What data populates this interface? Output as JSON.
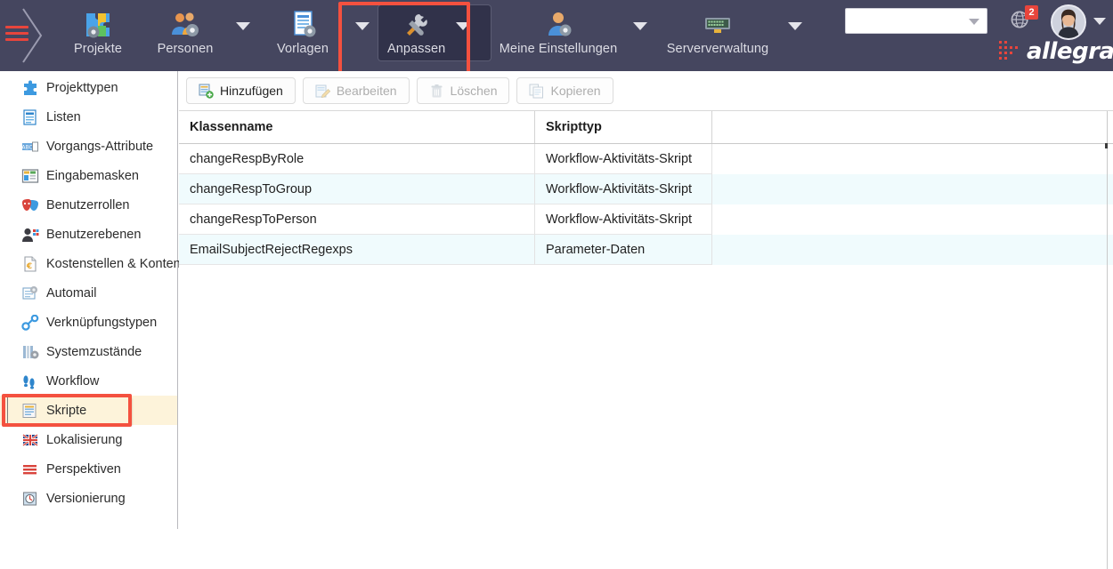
{
  "header": {
    "burger_icon": "hamburger-menu-icon",
    "nav": [
      {
        "label": "Projekte",
        "icon": "puzzle-gear-icon",
        "has_caret": false,
        "highlighted": false
      },
      {
        "label": "Personen",
        "icon": "people-gear-icon",
        "has_caret": true,
        "highlighted": false
      },
      {
        "label": "Vorlagen",
        "icon": "document-gear-icon",
        "has_caret": true,
        "highlighted": false
      },
      {
        "label": "Anpassen",
        "icon": "tools-icon",
        "has_caret": true,
        "highlighted": true
      },
      {
        "label": "Meine Einstellungen",
        "icon": "user-gear-icon",
        "has_caret": true,
        "highlighted": false
      },
      {
        "label": "Serververwaltung",
        "icon": "server-icon",
        "has_caret": true,
        "highlighted": false
      }
    ],
    "search": {
      "value": "",
      "placeholder": "",
      "icon": "chevron-down-icon"
    },
    "globe": {
      "icon": "globe-icon",
      "badge": "2"
    },
    "avatar": {
      "icon": "user-avatar",
      "caret_icon": "chevron-down-icon"
    },
    "brand": {
      "text": "allegra",
      "mark_icon": "allegra-dots-logo"
    },
    "colors": {
      "bar_bg": "#45465f",
      "tile_bg": "#31324a",
      "highlight": "#f4513f",
      "badge": "#e8453c"
    }
  },
  "sidebar": {
    "items": [
      {
        "label": "Projekttypen",
        "icon": "puzzle-icon",
        "active": false
      },
      {
        "label": "Listen",
        "icon": "list-icon",
        "active": false
      },
      {
        "label": "Vorgangs-Attribute",
        "icon": "abc-field-icon",
        "active": false
      },
      {
        "label": "Eingabemasken",
        "icon": "form-layout-icon",
        "active": false
      },
      {
        "label": "Benutzerrollen",
        "icon": "theater-masks-icon",
        "active": false
      },
      {
        "label": "Benutzerebenen",
        "icon": "user-levels-icon",
        "active": false
      },
      {
        "label": "Kostenstellen & Konten",
        "icon": "euro-document-icon",
        "active": false
      },
      {
        "label": "Automail",
        "icon": "automail-icon",
        "active": false
      },
      {
        "label": "Verknüpfungstypen",
        "icon": "link-chain-icon",
        "active": false
      },
      {
        "label": "Systemzustände",
        "icon": "system-state-icon",
        "active": false
      },
      {
        "label": "Workflow",
        "icon": "footsteps-icon",
        "active": false
      },
      {
        "label": "Skripte",
        "icon": "script-icon",
        "active": true
      },
      {
        "label": "Lokalisierung",
        "icon": "uk-flag-icon",
        "active": false
      },
      {
        "label": "Perspektiven",
        "icon": "red-bars-icon",
        "active": false
      },
      {
        "label": "Versionierung",
        "icon": "clock-version-icon",
        "active": false
      }
    ],
    "active_highlight_color": "#fdf3da"
  },
  "toolbar": {
    "buttons": [
      {
        "label": "Hinzufügen",
        "icon": "add-script-icon",
        "enabled": true
      },
      {
        "label": "Bearbeiten",
        "icon": "edit-pencil-icon",
        "enabled": false
      },
      {
        "label": "Löschen",
        "icon": "trash-icon",
        "enabled": false
      },
      {
        "label": "Kopieren",
        "icon": "copy-icon",
        "enabled": false
      }
    ]
  },
  "grid": {
    "columns": [
      "Klassenname",
      "Skripttyp",
      ""
    ],
    "rows": [
      {
        "klassenname": "changeRespByRole",
        "skripttyp": "Workflow-Aktivitäts-Skript"
      },
      {
        "klassenname": "changeRespToGroup",
        "skripttyp": "Workflow-Aktivitäts-Skript"
      },
      {
        "klassenname": "changeRespToPerson",
        "skripttyp": "Workflow-Aktivitäts-Skript"
      },
      {
        "klassenname": "EmailSubjectRejectRegexps",
        "skripttyp": "Parameter-Daten"
      }
    ]
  }
}
